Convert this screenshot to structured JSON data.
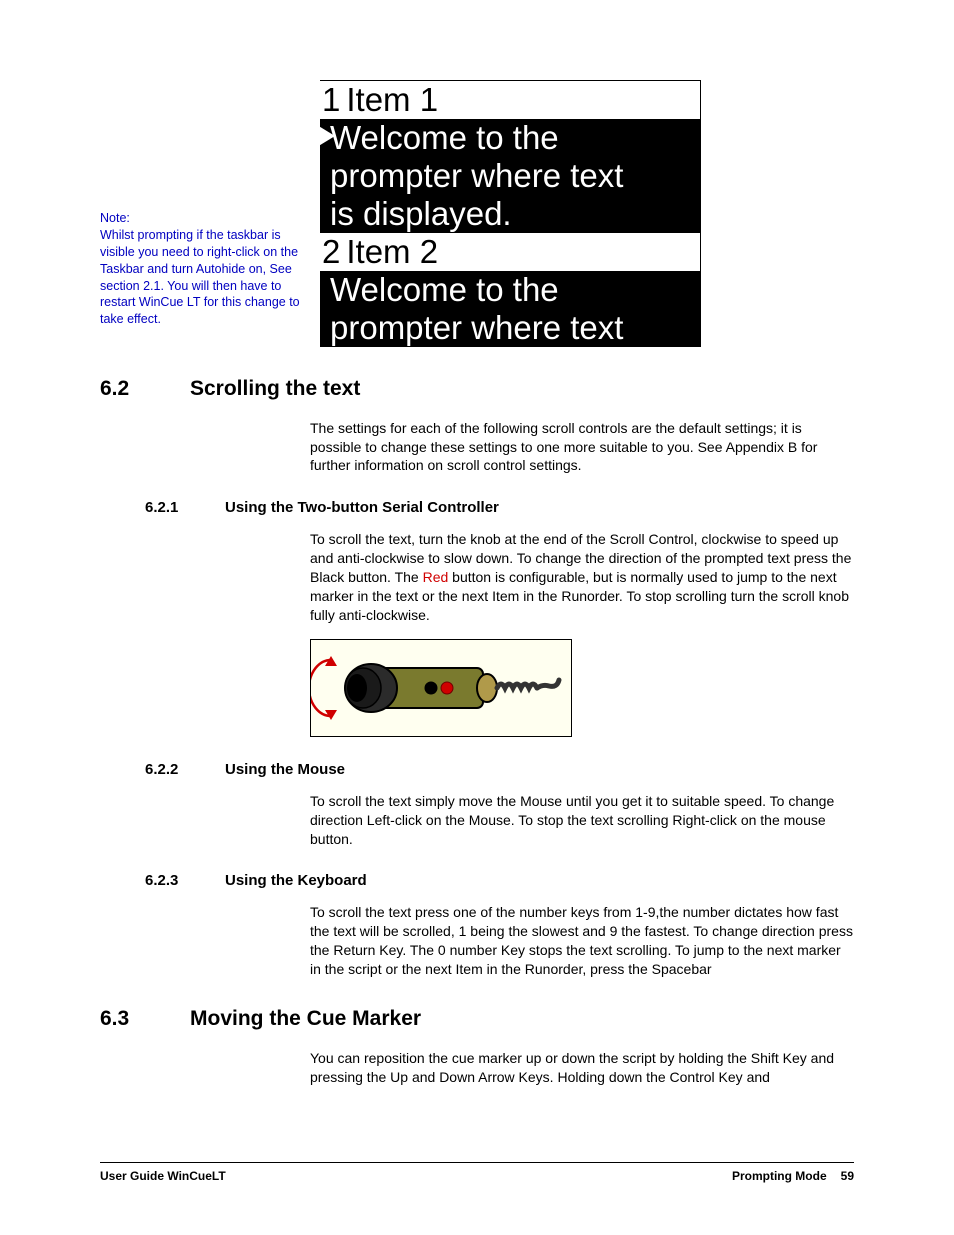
{
  "sidenote": {
    "label": "Note:",
    "text": "Whilst prompting if the taskbar is visible you need to right-click on the Taskbar and turn Autohide on, See section 2.1. You will then have to restart WinCue LT for this change to take effect."
  },
  "prompter": {
    "item1_num": "1",
    "item1_label": "Item 1",
    "body1a": "Welcome to the",
    "body1b": "prompter where text",
    "body1c": "is displayed.",
    "item2_num": "2",
    "item2_label": "Item 2",
    "body2a": "Welcome to the",
    "body2b": "prompter where text"
  },
  "sections": {
    "s62_num": "6.2",
    "s62_title": "Scrolling the text",
    "s62_intro": "The settings for each of the following scroll controls are the default settings; it is possible to change these settings to one more suitable to you. See Appendix B for further information on scroll control settings.",
    "s621_num": "6.2.1",
    "s621_title": "Using the Two-button Serial Controller",
    "s621_body_pre": "To scroll the text, turn the knob at the end of the Scroll Control, clockwise to speed up and anti-clockwise to slow down. To change the direction of the prompted text press the Black button. The ",
    "s621_red": "Red",
    "s621_body_post": " button is configurable, but is normally used to jump to the next marker in the text or the next Item in the Runorder. To stop scrolling turn the scroll knob fully anti-clockwise.",
    "s622_num": "6.2.2",
    "s622_title": "Using the Mouse",
    "s622_body": "To scroll the text simply move the Mouse until you get it to suitable speed. To change direction Left-click on the Mouse. To stop the text scrolling Right-click on the mouse button.",
    "s623_num": "6.2.3",
    "s623_title": "Using the Keyboard",
    "s623_body": "To scroll the text press one of the number keys from 1-9,the number dictates how fast the text will be scrolled, 1 being the slowest and 9 the fastest. To change direction press the Return Key. The 0 number Key stops the text scrolling. To jump to the next marker in the script or the next Item in the Runorder, press the Spacebar",
    "s63_num": "6.3",
    "s63_title": "Moving the Cue Marker",
    "s63_body": "You can reposition the cue marker up or down the script by holding the Shift Key and pressing the Up and Down Arrow Keys. Holding down the Control Key and"
  },
  "footer": {
    "left": "User Guide WinCueLT",
    "right_label": "Prompting Mode",
    "page": "59"
  }
}
